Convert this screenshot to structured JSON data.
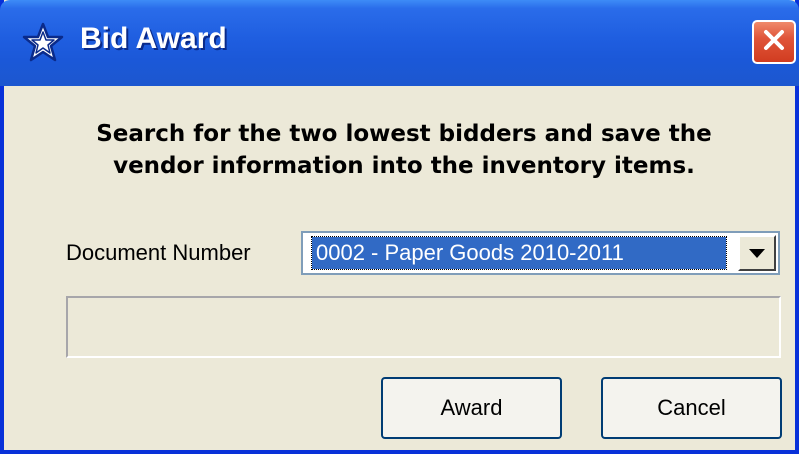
{
  "window": {
    "title": "Bid Award",
    "title_icon": "star-outline-icon",
    "close_icon": "close-icon"
  },
  "instructions": {
    "line1": "Search for the two lowest bidders and save the",
    "line2": "vendor information into the inventory items."
  },
  "form": {
    "document_number_label": "Document Number",
    "document_number_value": "0002 - Paper Goods 2010-2011"
  },
  "progress": {
    "value": 0
  },
  "buttons": {
    "award_label": "Award",
    "cancel_label": "Cancel"
  },
  "colors": {
    "titlebar": "#1f5ee0",
    "window_bg": "#ece9d8",
    "selection": "#316ac5",
    "close": "#e0553a"
  }
}
